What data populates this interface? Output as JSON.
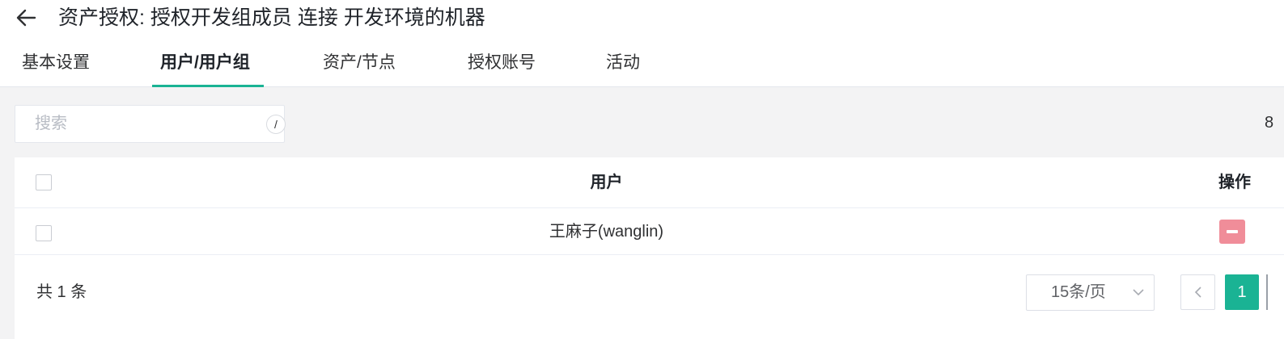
{
  "header": {
    "title": "资产授权: 授权开发组成员 连接 开发环境的机器",
    "back_icon": "arrow-left-icon"
  },
  "tabs": [
    {
      "label": "基本设置",
      "active": false
    },
    {
      "label": "用户/用户组",
      "active": true
    },
    {
      "label": "资产/节点",
      "active": false
    },
    {
      "label": "授权账号",
      "active": false
    },
    {
      "label": "活动",
      "active": false
    }
  ],
  "search": {
    "value": "",
    "placeholder": "搜索",
    "shortcut": "/"
  },
  "toolbar": {
    "right_edge_text": "8"
  },
  "table": {
    "columns": [
      {
        "key": "user",
        "label": "用户"
      },
      {
        "key": "action",
        "label": "操作"
      }
    ],
    "rows": [
      {
        "user": "王麻子(wanglin)",
        "action_icon": "minus-icon"
      }
    ]
  },
  "pagination": {
    "total_text": "共 1 条",
    "page_size": "15条/页",
    "current_page": "1",
    "prev_icon": "chevron-left-icon",
    "dropdown_icon": "chevron-down-icon"
  },
  "colors": {
    "accent": "#1ab394",
    "danger": "#f08d99",
    "background": "#f3f3f4"
  }
}
